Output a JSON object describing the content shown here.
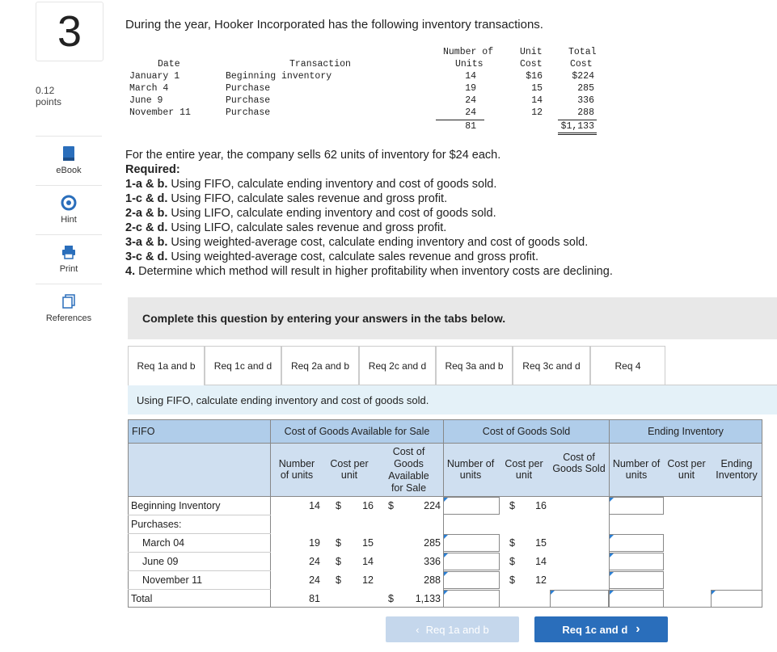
{
  "question": {
    "number": "3",
    "points_value": "0.12",
    "points_label": "points"
  },
  "tools": [
    {
      "label": "eBook",
      "icon": "book-icon"
    },
    {
      "label": "Hint",
      "icon": "hint-icon"
    },
    {
      "label": "Print",
      "icon": "print-icon"
    },
    {
      "label": "References",
      "icon": "references-icon"
    }
  ],
  "intro": "During the year, Hooker Incorporated has the following inventory transactions.",
  "transactions": {
    "headers": {
      "date": "Date",
      "transaction": "Transaction",
      "units_top": "Number of",
      "units_bottom": "Units",
      "cost_top": "Unit",
      "cost_bottom": "Cost",
      "total_top": "Total",
      "total_bottom": "Cost"
    },
    "rows": [
      {
        "date": "January 1",
        "transaction": "Beginning inventory",
        "units": "14",
        "unit_cost": "$16",
        "total": "$224"
      },
      {
        "date": "March 4",
        "transaction": "Purchase",
        "units": "19",
        "unit_cost": "15",
        "total": "285"
      },
      {
        "date": "June 9",
        "transaction": "Purchase",
        "units": "24",
        "unit_cost": "14",
        "total": "336"
      },
      {
        "date": "November 11",
        "transaction": "Purchase",
        "units": "24",
        "unit_cost": "12",
        "total": "288"
      }
    ],
    "total_units": "81",
    "total_cost": "$1,133"
  },
  "sales_line": "For the entire year, the company sells 62 units of inventory for $24 each.",
  "required_label": "Required:",
  "requirements": [
    {
      "tag": "1-a & b.",
      "text": " Using FIFO, calculate ending inventory and cost of goods sold."
    },
    {
      "tag": "1-c & d.",
      "text": " Using FIFO, calculate sales revenue and gross profit."
    },
    {
      "tag": "2-a & b.",
      "text": " Using LIFO, calculate ending inventory and cost of goods sold."
    },
    {
      "tag": "2-c & d.",
      "text": " Using LIFO, calculate sales revenue and gross profit."
    },
    {
      "tag": "3-a & b.",
      "text": " Using weighted-average cost, calculate ending inventory and cost of goods sold."
    },
    {
      "tag": "3-c & d.",
      "text": " Using weighted-average cost, calculate sales revenue and gross profit."
    },
    {
      "tag": "4.",
      "text": " Determine which method will result in higher profitability when inventory costs are declining."
    }
  ],
  "complete_prompt": "Complete this question by entering your answers in the tabs below.",
  "tabs": [
    "Req 1a and b",
    "Req 1c and d",
    "Req 2a and b",
    "Req 2c and d",
    "Req 3a and b",
    "Req 3c and d",
    "Req 4"
  ],
  "active_tab": "Req 1a and b",
  "instruction": "Using FIFO, calculate ending inventory and cost of goods sold.",
  "grid": {
    "method": "FIFO",
    "groups": {
      "available": "Cost of Goods Available for Sale",
      "sold": "Cost of Goods Sold",
      "ending": "Ending Inventory"
    },
    "subheaders": {
      "avail_units": "Number of units",
      "avail_cost": "Cost per unit",
      "avail_total": "Cost of Goods Available for Sale",
      "sold_units": "Number of units",
      "sold_cost": "Cost per unit",
      "sold_total": "Cost of Goods Sold",
      "end_units": "Number of units",
      "end_cost": "Cost per unit",
      "end_total": "Ending Inventory"
    },
    "rows": {
      "beginning": {
        "label": "Beginning Inventory",
        "units": "14",
        "dollar": "$",
        "cost": "16",
        "dollar2": "$",
        "total": "224",
        "sold_dollar": "$",
        "sold_cost": "16"
      },
      "purchases": {
        "label": "Purchases:"
      },
      "march": {
        "label": "March 04",
        "units": "19",
        "dollar": "$",
        "cost": "15",
        "total": "285",
        "sold_dollar": "$",
        "sold_cost": "15"
      },
      "june": {
        "label": "June 09",
        "units": "24",
        "dollar": "$",
        "cost": "14",
        "total": "336",
        "sold_dollar": "$",
        "sold_cost": "14"
      },
      "november": {
        "label": "November 11",
        "units": "24",
        "dollar": "$",
        "cost": "12",
        "total": "288",
        "sold_dollar": "$",
        "sold_cost": "12"
      },
      "total": {
        "label": "Total",
        "units": "81",
        "dollar2": "$",
        "total": "1,133"
      }
    }
  },
  "nav": {
    "prev": "Req 1a and b",
    "next": "Req 1c and d"
  }
}
